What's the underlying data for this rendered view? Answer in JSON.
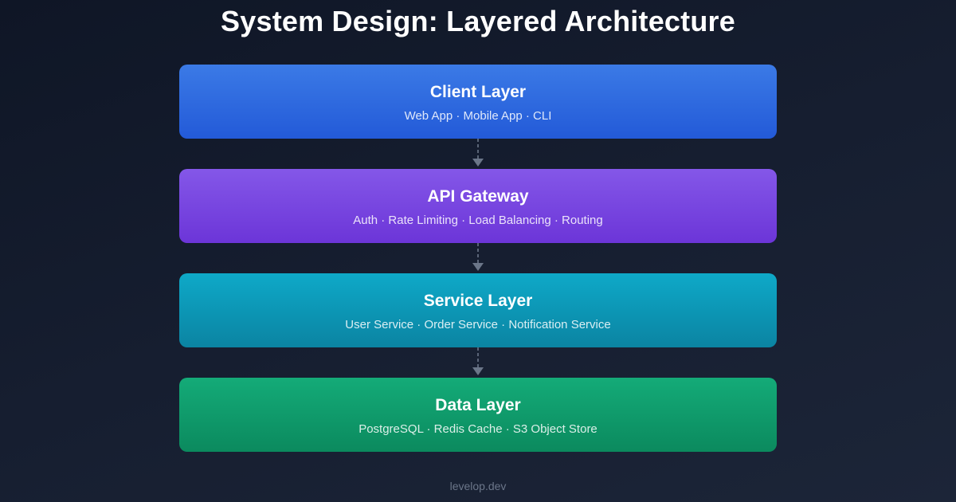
{
  "title": "System Design: Layered Architecture",
  "layers": [
    {
      "name": "Client Layer",
      "components": "Web App · Mobile App · CLI",
      "color": "#2a63dd"
    },
    {
      "name": "API Gateway",
      "components": "Auth · Rate Limiting · Load Balancing · Routing",
      "color": "#7640df"
    },
    {
      "name": "Service Layer",
      "components": "User Service · Order Service · Notification Service",
      "color": "#0c97b6"
    },
    {
      "name": "Data Layer",
      "components": "PostgreSQL · Redis Cache · S3 Object Store",
      "color": "#109a6b"
    }
  ],
  "connector_color": "#6b7689",
  "footer": "levelop.dev"
}
